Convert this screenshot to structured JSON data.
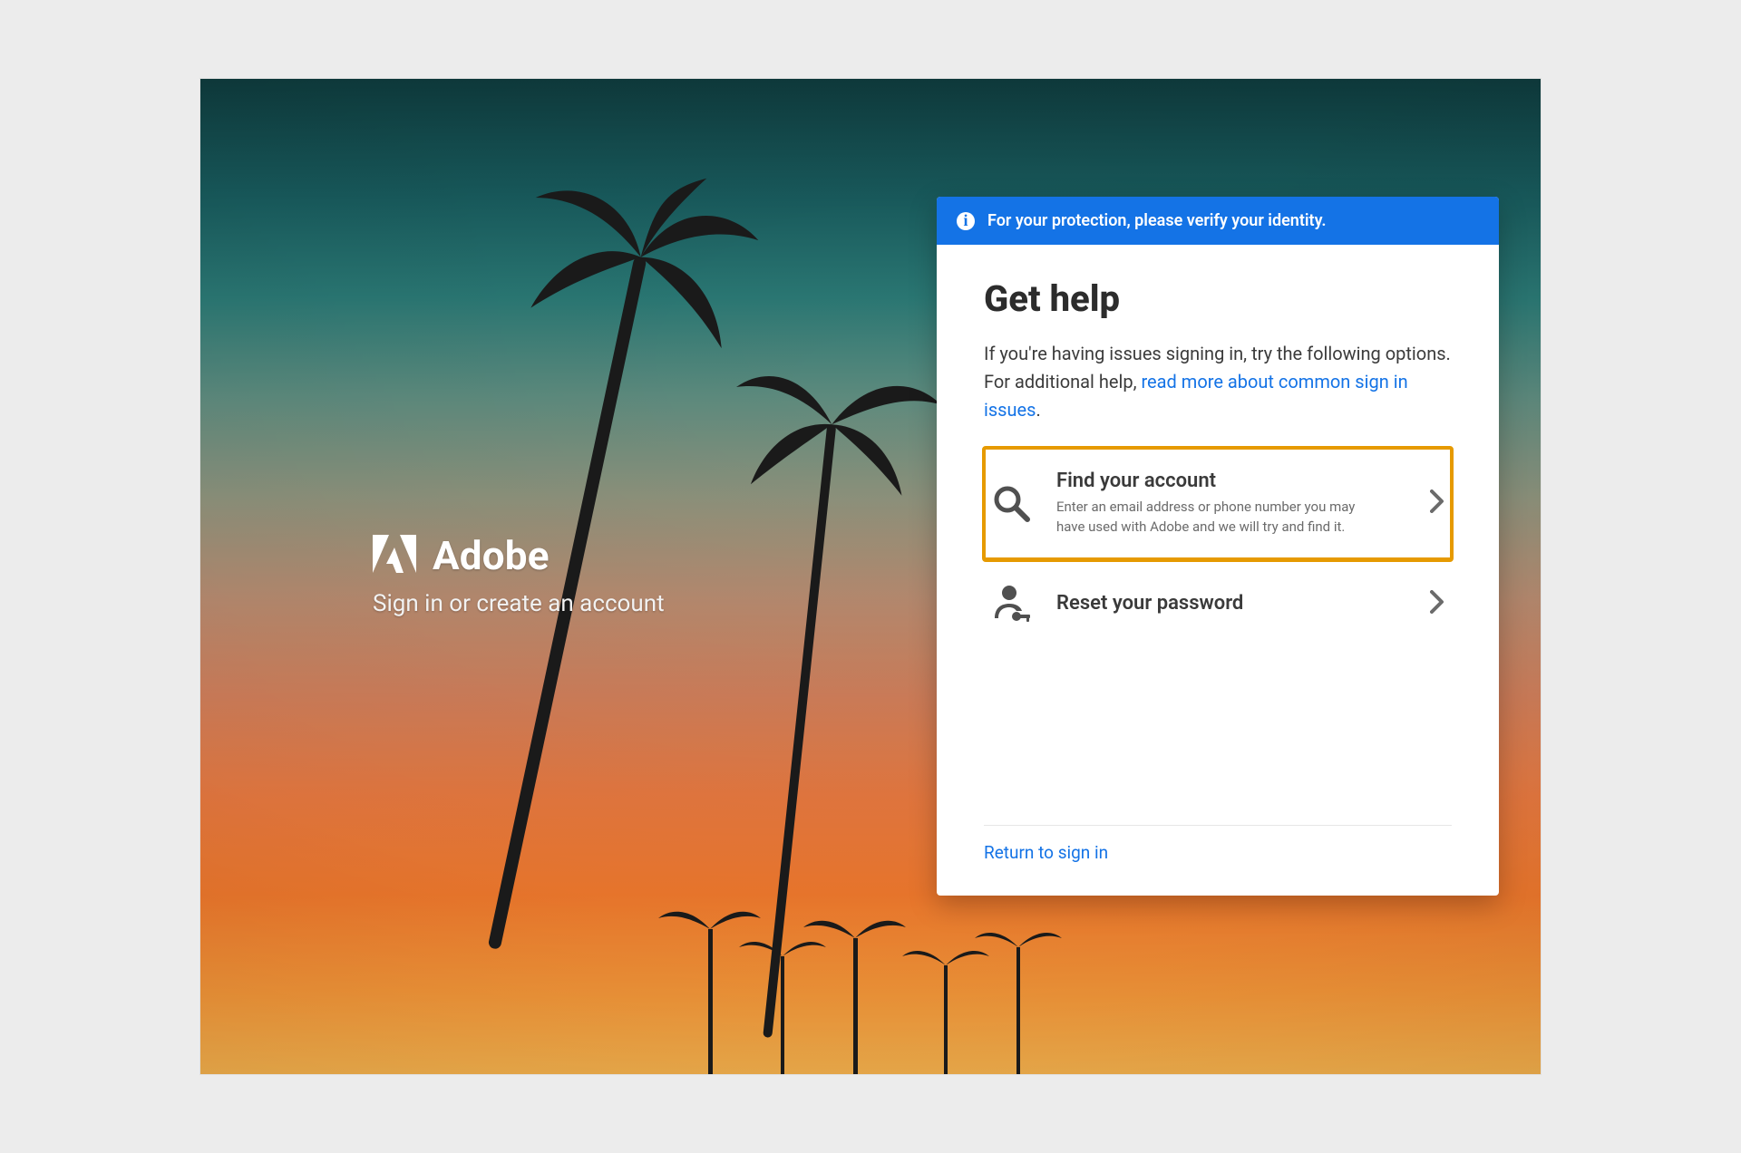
{
  "brand": {
    "name": "Adobe",
    "subtitle": "Sign in or create an account"
  },
  "banner": {
    "text": "For your protection, please verify your identity."
  },
  "card": {
    "title": "Get help",
    "intro_prefix": "If you're having issues signing in, try the following options. For additional help, ",
    "intro_link": "read more about common sign in issues",
    "intro_suffix": ".",
    "options": [
      {
        "id": "find-account",
        "label": "Find your account",
        "desc": "Enter an email address or phone number you may have used with Adobe and we will try and find it.",
        "highlighted": true
      },
      {
        "id": "reset-password",
        "label": "Reset your password",
        "desc": "",
        "highlighted": false
      }
    ],
    "return_label": "Return to sign in"
  },
  "colors": {
    "accent": "#1473e6",
    "highlight": "#e69a00"
  }
}
